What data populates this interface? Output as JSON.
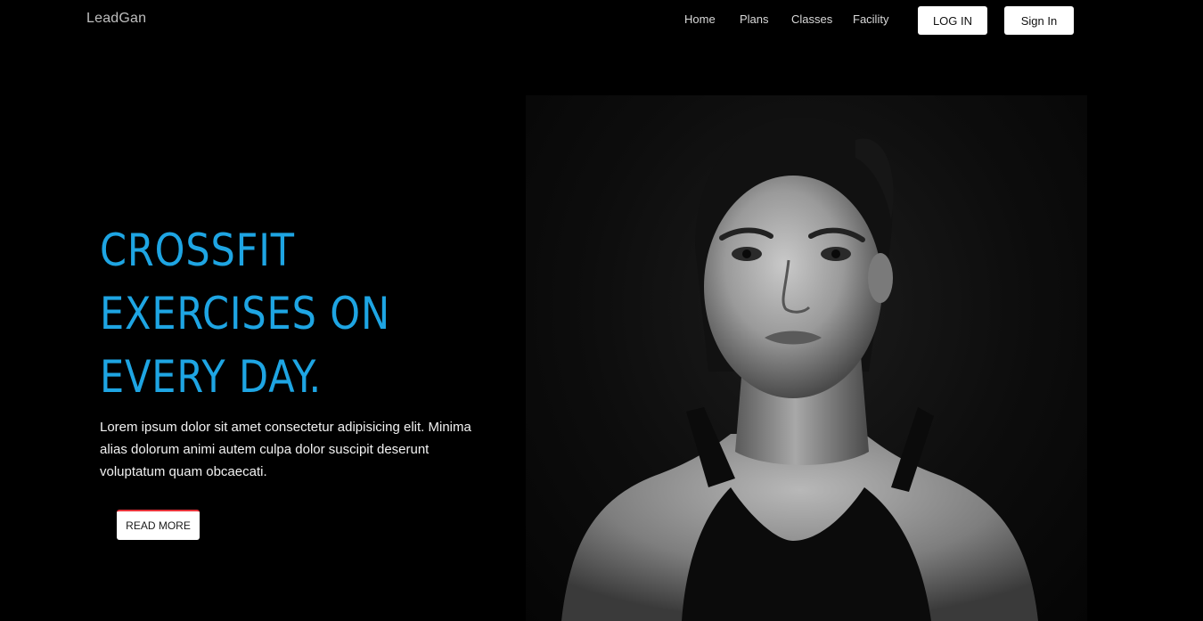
{
  "navbar": {
    "brand": "LeadGan",
    "links": [
      "Home",
      "Plans",
      "Classes",
      "Facility"
    ],
    "login_label": "LOG IN",
    "signin_label": "Sign In"
  },
  "hero": {
    "title_lines": [
      "CROSSFIT",
      "EXERCISES ON",
      "EVERY DAY."
    ],
    "description": "Lorem ipsum dolor sit amet consectetur adipisicing elit. Minima alias dolorum animi autem culpa dolor suscipit deserunt voluptatum quam obcaecati.",
    "cta_label": "READ MORE",
    "photo_icon": "woman-portrait-photo"
  },
  "colors": {
    "background": "#000000",
    "title_accent": "#1ea5e3",
    "button_bg": "#ffffff",
    "cta_border": "#e8343b"
  }
}
